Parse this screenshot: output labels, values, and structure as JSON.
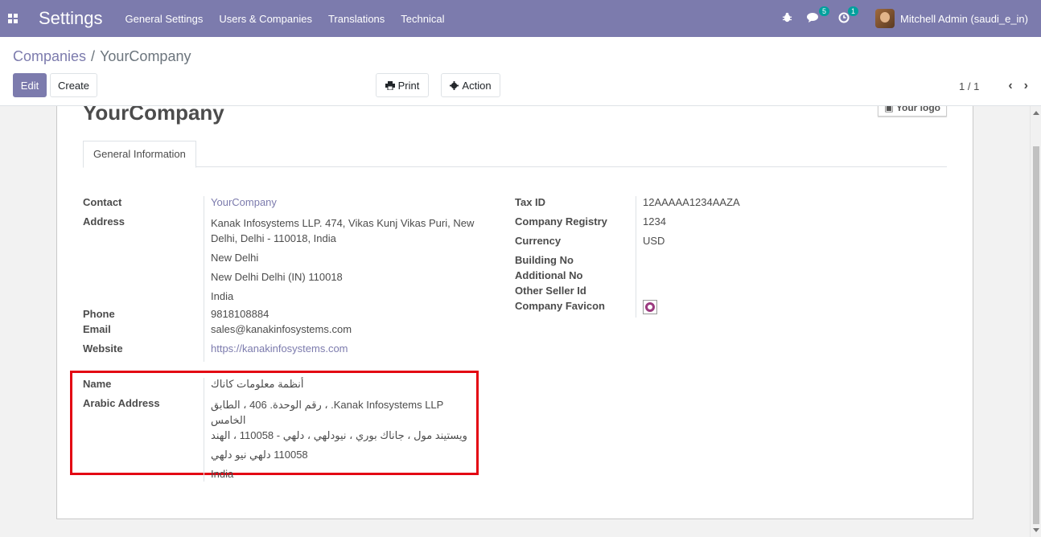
{
  "navbar": {
    "app_title": "Settings",
    "menu": [
      "General Settings",
      "Users & Companies",
      "Translations",
      "Technical"
    ],
    "messages_count": "5",
    "activities_count": "1",
    "user_name": "Mitchell Admin (saudi_e_in)"
  },
  "breadcrumb": {
    "parent": "Companies",
    "separator": "/",
    "current": "YourCompany"
  },
  "buttons": {
    "edit": "Edit",
    "create": "Create",
    "print": "Print",
    "action": "Action"
  },
  "pager": {
    "value": "1 / 1"
  },
  "form": {
    "company_name": "YourCompany",
    "logo_label": "Your logo",
    "tab": "General Information",
    "left": {
      "contact_label": "Contact",
      "contact": "YourCompany",
      "address_label": "Address",
      "address_line1": "Kanak Infosystems LLP. 474, Vikas Kunj Vikas Puri, New",
      "address_line2": "Delhi, Delhi - 110018, India",
      "address_city": "New Delhi",
      "address_state_zip": "New Delhi  Delhi (IN)  110018",
      "address_country": "India",
      "phone_label": "Phone",
      "phone": "9818108884",
      "email_label": "Email",
      "email": "sales@kanakinfosystems.com",
      "website_label": "Website",
      "website": "https://kanakinfosystems.com"
    },
    "arabic": {
      "name_label": "Name",
      "name": "أنظمة معلومات كاناك",
      "address_label": "Arabic Address",
      "address_line1": "Kanak Infosystems LLP. ، رقم الوحدة. 406 ، الطابق الخامس",
      "address_line2": "ويستيند مول ، جاناك بوري ، نيودلهي ، دلهي - 110058 ، الهند",
      "address_line3": "110058  دلهي  نيو دلهي",
      "address_country": "India"
    },
    "right": {
      "tax_id_label": "Tax ID",
      "tax_id": "12AAAAA1234AAZA",
      "registry_label": "Company Registry",
      "registry": "1234",
      "currency_label": "Currency",
      "currency": "USD",
      "building_label": "Building No",
      "additional_label": "Additional No",
      "other_seller_label": "Other Seller Id",
      "favicon_label": "Company Favicon"
    }
  },
  "colors": {
    "navbar": "#7c7bad",
    "link": "#7c7bad",
    "highlight": "#e30613"
  }
}
